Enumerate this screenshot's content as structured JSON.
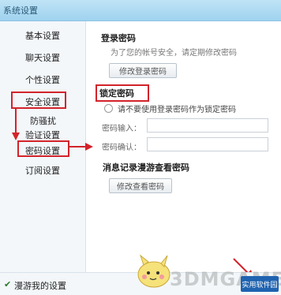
{
  "window": {
    "title": "系统设置"
  },
  "sidebar": {
    "items": [
      {
        "label": "基本设置"
      },
      {
        "label": "聊天设置"
      },
      {
        "label": "个性设置"
      },
      {
        "label": "安全设置"
      },
      {
        "label": "防骚扰"
      },
      {
        "label": "验证设置"
      },
      {
        "label": "密码设置"
      },
      {
        "label": "订阅设置"
      }
    ]
  },
  "login_password": {
    "title": "登录密码",
    "hint": "为了您的帐号安全，请定期修改密码",
    "button": "修改登录密码"
  },
  "lock_password": {
    "title": "锁定密码",
    "option": "请不要使用登录密码作为锁定密码",
    "field1_label": "密码输入：",
    "field2_label": "密码确认："
  },
  "chat_history_password": {
    "title": "消息记录漫游查看密码",
    "button": "修改查看密码"
  },
  "footer": {
    "label": "漫游我的设置"
  },
  "branding": {
    "watermark": "3DMGAME",
    "logo": "实用软件园"
  },
  "colors": {
    "highlight": "#d3232b",
    "titlebar": "#9fd2ef"
  }
}
